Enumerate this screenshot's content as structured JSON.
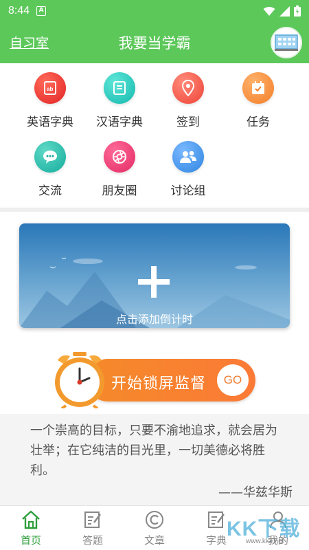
{
  "status_bar": {
    "time": "8:44",
    "notification_glyph": "A",
    "icons": [
      "wifi-icon",
      "signal-icon",
      "battery-icon"
    ]
  },
  "header": {
    "left_link": "自习室",
    "title": "我要当学霸",
    "avatar_icon": "classroom-avatar-icon"
  },
  "grid": {
    "items": [
      {
        "label": "英语字典",
        "icon": "english-dictionary-icon",
        "color": "#ee2c2c"
      },
      {
        "label": "汉语字典",
        "icon": "chinese-dictionary-icon",
        "color": "#19c2b8"
      },
      {
        "label": "签到",
        "icon": "location-pin-icon",
        "color": "#f25245"
      },
      {
        "label": "任务",
        "icon": "calendar-task-icon",
        "color": "#f5893a"
      },
      {
        "label": "交流",
        "icon": "chat-bubble-icon",
        "color": "#19b5a4"
      },
      {
        "label": "朋友圈",
        "icon": "aperture-icon",
        "color": "#ec2d6b"
      },
      {
        "label": "讨论组",
        "icon": "group-users-icon",
        "color": "#3a92e6"
      }
    ]
  },
  "countdown": {
    "label": "点击添加倒计时"
  },
  "lock": {
    "label": "开始锁屏监督",
    "go_label": "GO"
  },
  "quote": {
    "text": "一个崇高的目标，只要不渝地追求，就会居为壮举；在它纯洁的目光里，一切美德必将胜利。",
    "author": "——华兹华斯"
  },
  "nav": {
    "items": [
      {
        "label": "首页",
        "icon": "home-icon",
        "active": true
      },
      {
        "label": "答题",
        "icon": "edit-note-icon",
        "active": false
      },
      {
        "label": "文章",
        "icon": "copyright-circle-icon",
        "active": false
      },
      {
        "label": "字典",
        "icon": "dictionary-note-icon",
        "active": false
      },
      {
        "label": "我的",
        "icon": "person-icon",
        "active": false
      }
    ]
  },
  "watermark": {
    "text": "KK下载",
    "url": "www.kkx.net"
  },
  "colors": {
    "brand_green": "#5cc85a",
    "accent_orange": "#f58a2a",
    "nav_active": "#2e9e3c"
  }
}
